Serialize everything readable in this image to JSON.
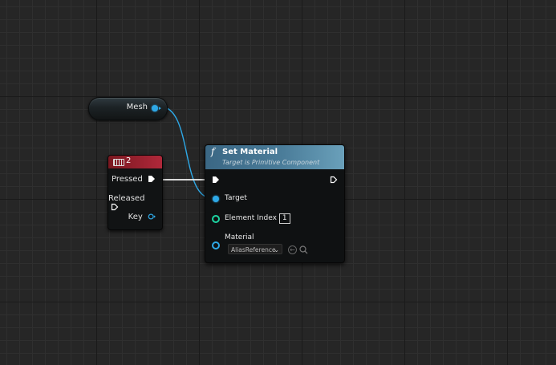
{
  "mesh_node": {
    "label": "Mesh"
  },
  "key_event_node": {
    "key_name": "2",
    "pins": {
      "pressed": "Pressed",
      "released": "Released",
      "key": "Key"
    }
  },
  "set_material_node": {
    "icon": "f",
    "title": "Set Material",
    "subtitle": "Target is Primitive Component",
    "pins": {
      "target": "Target",
      "element_index": "Element Index",
      "element_index_value": "1",
      "material": "Material"
    },
    "material_dropdown_value": "AliasReference"
  },
  "colors": {
    "object_pin": "#2ea8e6",
    "integer_pin": "#1dd6a3",
    "event_header": "#b0283a",
    "function_header": "#4a7c99"
  }
}
